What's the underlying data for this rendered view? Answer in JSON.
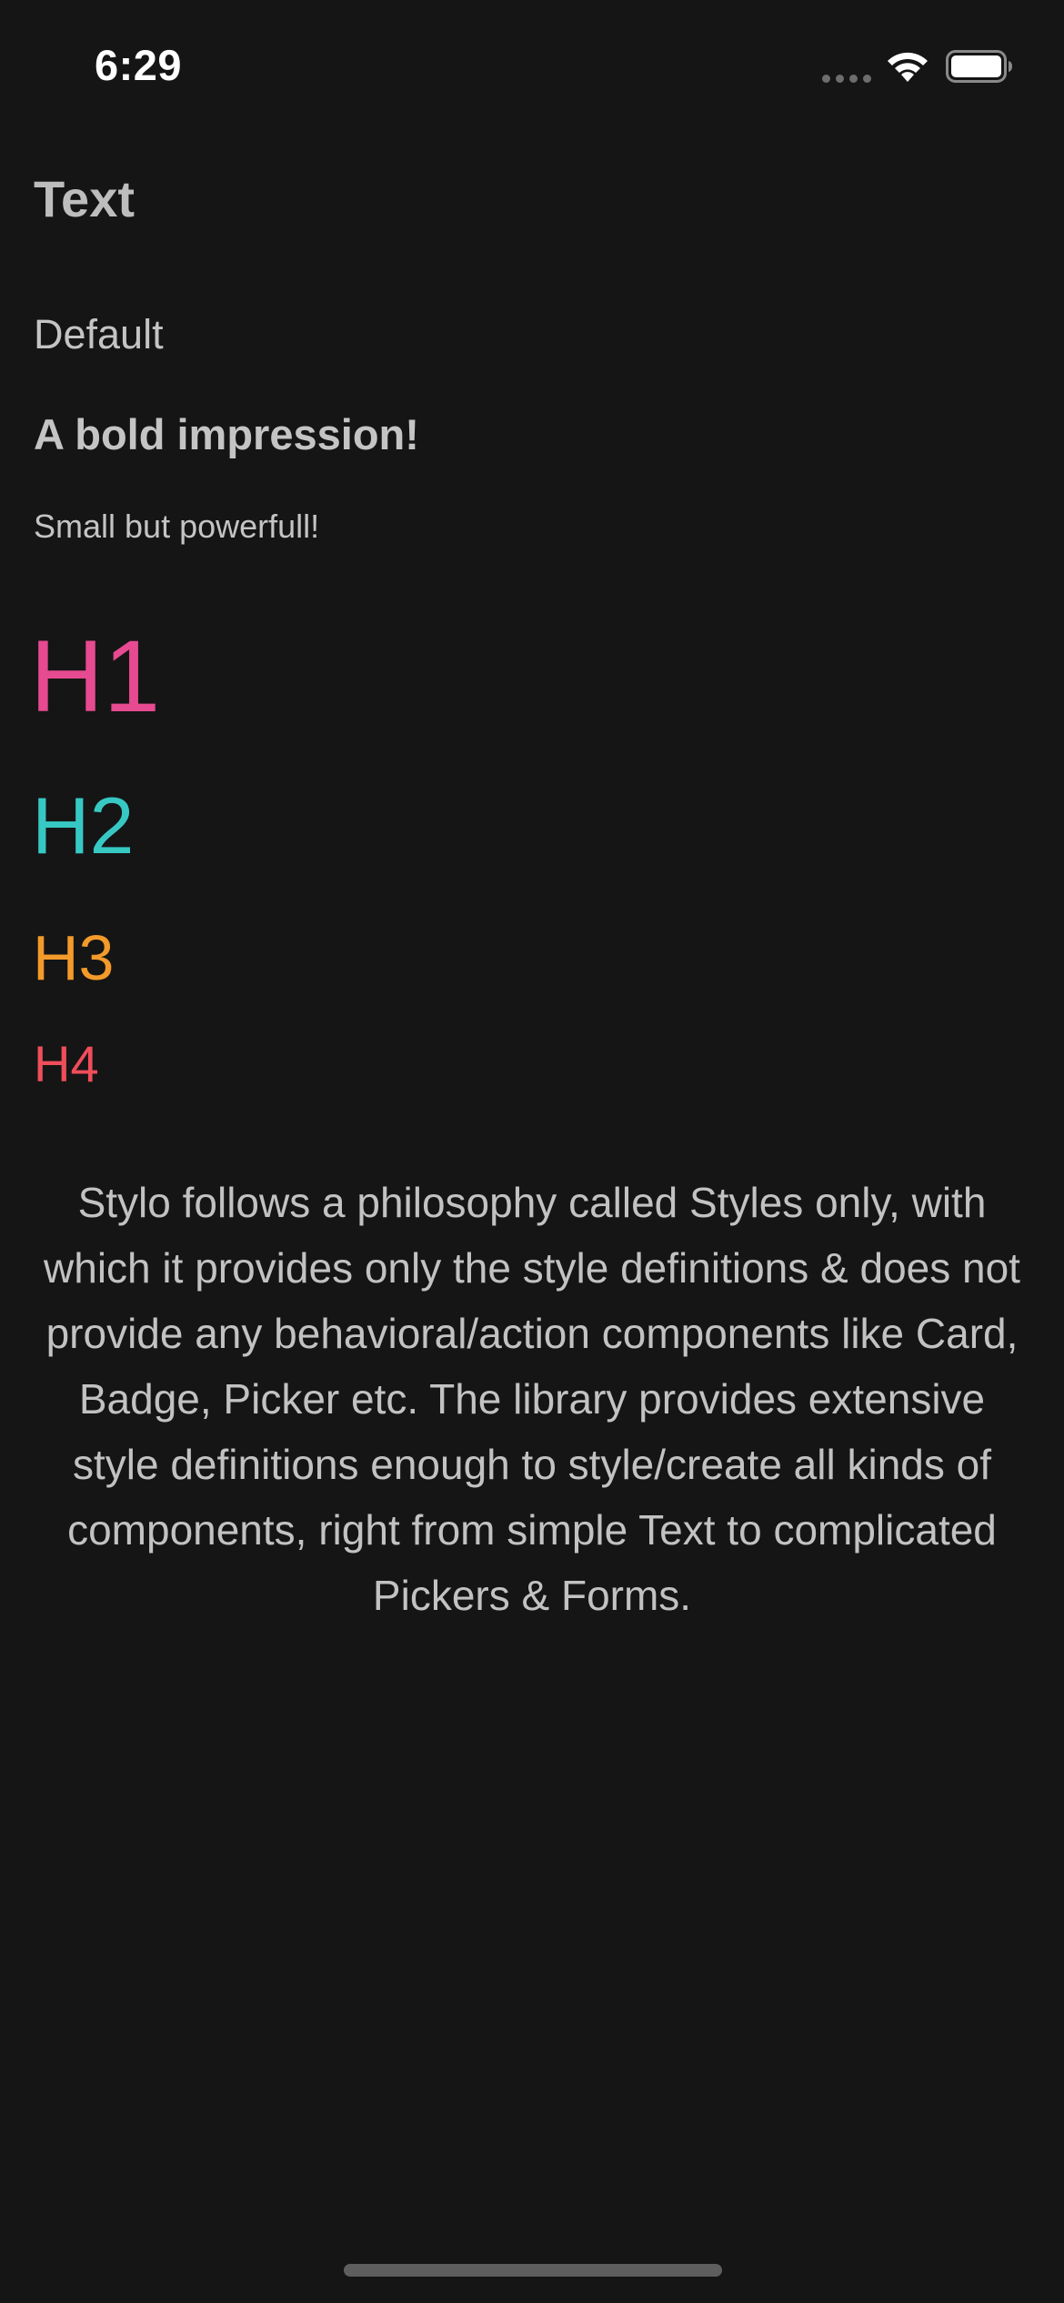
{
  "status_bar": {
    "time": "6:29",
    "icons": [
      "cellular-signal-icon",
      "wifi-icon",
      "battery-icon"
    ]
  },
  "screen": {
    "title": "Text",
    "default_text": "Default",
    "bold_text": "A bold impression!",
    "small_text": "Small but powerfull!",
    "headings": {
      "h1": "H1",
      "h2": "H2",
      "h3": "H3",
      "h4": "H4"
    },
    "paragraph": "Stylo follows a philosophy called Styles only, with which it provides only the style definitions & does not provide any behavioral/action components like Card, Badge, Picker etc. The library provides extensive style definitions enough to style/create all kinds of components, right from simple Text to complicated Pickers & Forms."
  },
  "colors": {
    "background": "#151515",
    "h1": "#e64a90",
    "h2": "#37c8c4",
    "h3": "#f39a2a",
    "h4": "#ef4d5b",
    "text": "#c4c4c4"
  }
}
